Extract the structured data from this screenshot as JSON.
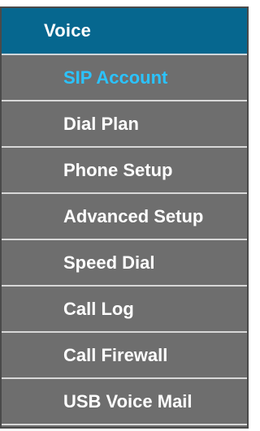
{
  "menu": {
    "header": "Voice",
    "items": [
      {
        "label": "SIP Account",
        "active": true
      },
      {
        "label": "Dial Plan",
        "active": false
      },
      {
        "label": "Phone Setup",
        "active": false
      },
      {
        "label": "Advanced Setup",
        "active": false
      },
      {
        "label": "Speed Dial",
        "active": false
      },
      {
        "label": "Call Log",
        "active": false
      },
      {
        "label": "Call Firewall",
        "active": false
      },
      {
        "label": "USB Voice Mail",
        "active": false
      }
    ]
  },
  "colors": {
    "header_bg": "#06678f",
    "item_bg": "#6e6e6e",
    "item_text": "#ffffff",
    "active_text": "#2bc3ff"
  }
}
